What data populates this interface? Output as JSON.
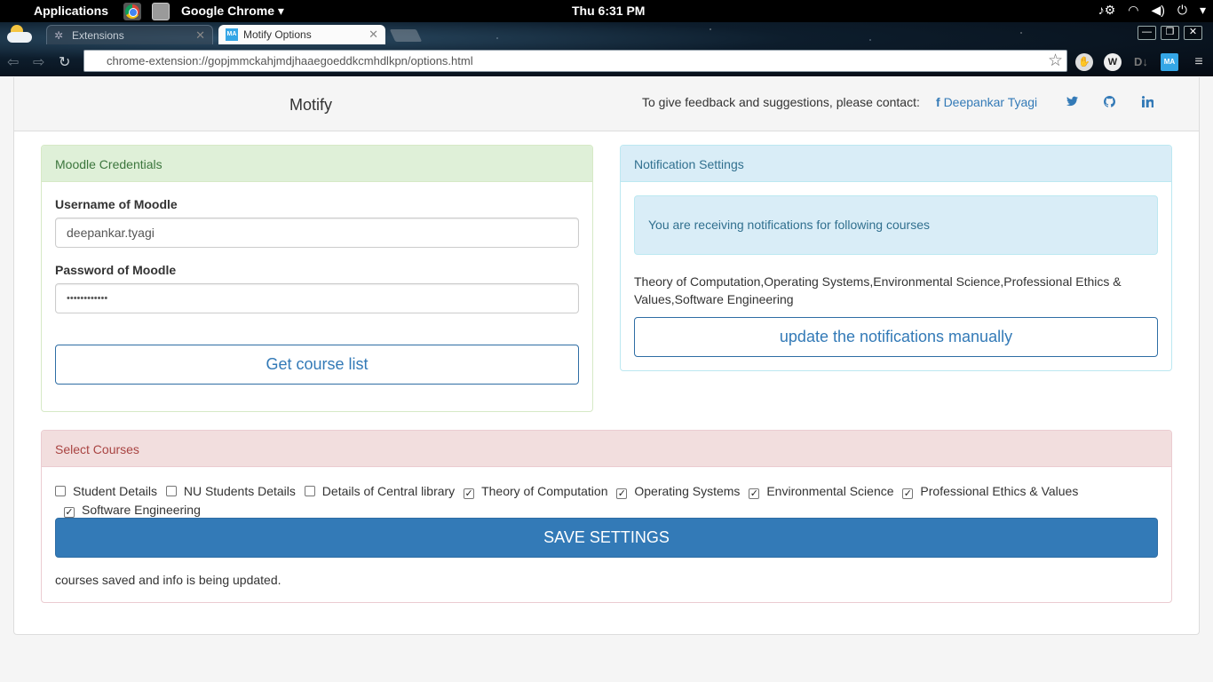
{
  "os_panel": {
    "apps_menu": "Applications",
    "active_app": "Google Chrome ▾",
    "clock": "Thu  6:31 PM",
    "tray_icons": [
      "music-note-icon",
      "wifi-icon",
      "volume-icon",
      "power-icon",
      "chevron-down-icon"
    ]
  },
  "browser": {
    "tabs": [
      {
        "title": "Extensions",
        "icon": "puzzle-icon",
        "active": false
      },
      {
        "title": "Motify Options",
        "icon": "motify-icon",
        "active": true
      }
    ],
    "url": "chrome-extension://gopjmmckahjmdjhaaegoeddkcmhdlkpn/options.html",
    "extension_icons": [
      "hand-icon",
      "wikipedia-icon",
      "downloader-icon",
      "motify-icon"
    ]
  },
  "header": {
    "brand": "Motify",
    "contact_text": "To give feedback and suggestions, please contact:",
    "facebook_name": "Deepankar Tyagi",
    "social_icons": [
      "facebook-icon",
      "twitter-icon",
      "github-icon",
      "linkedin-icon"
    ]
  },
  "credentials": {
    "heading": "Moodle Credentials",
    "username_label": "Username of Moodle",
    "username_value": "deepankar.tyagi",
    "password_label": "Password of Moodle",
    "password_value": "••••••••••••",
    "get_courses_button": "Get course list"
  },
  "notifications": {
    "heading": "Notification Settings",
    "alert_text": "You are receiving notifications for following courses",
    "courses_text": "Theory of Computation,Operating Systems,Environmental Science,Professional Ethics & Values,Software Engineering",
    "update_button": "update the notifications manually"
  },
  "courses": {
    "heading": "Select Courses",
    "items": [
      {
        "label": "Student Details",
        "checked": false
      },
      {
        "label": "NU Students Details",
        "checked": false
      },
      {
        "label": "Details of Central library",
        "checked": false
      },
      {
        "label": "Theory of Computation",
        "checked": true
      },
      {
        "label": "Operating Systems",
        "checked": true
      },
      {
        "label": "Environmental Science",
        "checked": true
      },
      {
        "label": "Professional Ethics & Values",
        "checked": true
      },
      {
        "label": "Software Engineering",
        "checked": true
      }
    ],
    "save_button": "SAVE SETTINGS",
    "status": "courses saved and info is being updated."
  }
}
